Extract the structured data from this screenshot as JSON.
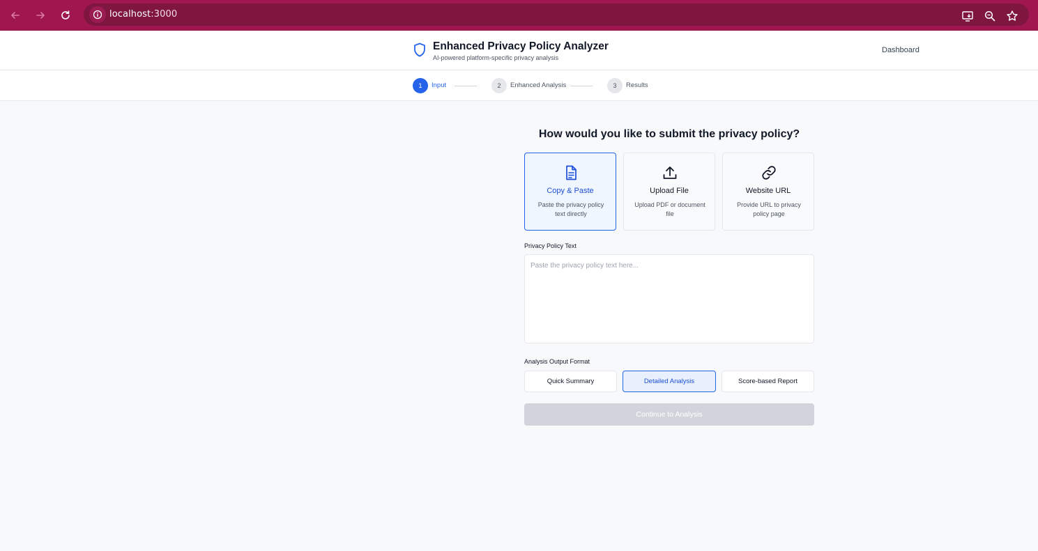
{
  "browser": {
    "url_host": "localhost",
    "url_port": ":3000",
    "icons": [
      "back-icon",
      "forward-icon",
      "reload-icon",
      "site-info-icon",
      "install-app-icon",
      "zoom-icon",
      "bookmark-star-icon"
    ]
  },
  "header": {
    "title": "Enhanced Privacy Policy Analyzer",
    "subtitle": "AI-powered platform-specific privacy analysis",
    "dashboard_link": "Dashboard"
  },
  "steps": [
    {
      "number": "1",
      "label": "Input",
      "state": "active"
    },
    {
      "number": "2",
      "label": "Enhanced Analysis",
      "state": "upcoming"
    },
    {
      "number": "3",
      "label": "Results",
      "state": "upcoming"
    }
  ],
  "main": {
    "question": "How would you like to submit the privacy policy?",
    "methods": [
      {
        "title": "Copy & Paste",
        "description": "Paste the privacy policy text directly",
        "icon": "document-icon",
        "selected": true
      },
      {
        "title": "Upload File",
        "description": "Upload PDF or document file",
        "icon": "upload-icon",
        "selected": false
      },
      {
        "title": "Website URL",
        "description": "Provide URL to privacy policy page",
        "icon": "link-icon",
        "selected": false
      }
    ],
    "policy_text_label": "Privacy Policy Text",
    "policy_text_placeholder": "Paste the privacy policy text here...",
    "policy_text_value": "",
    "format_label": "Analysis Output Format",
    "formats": [
      {
        "label": "Quick Summary",
        "selected": false
      },
      {
        "label": "Detailed Analysis",
        "selected": true
      },
      {
        "label": "Score-based Report",
        "selected": false
      }
    ],
    "continue_button": "Continue to Analysis",
    "continue_disabled": true
  },
  "colors": {
    "browser_bar": "#a0164f",
    "accent": "#2563eb",
    "disabled_button": "#d1d5db"
  }
}
